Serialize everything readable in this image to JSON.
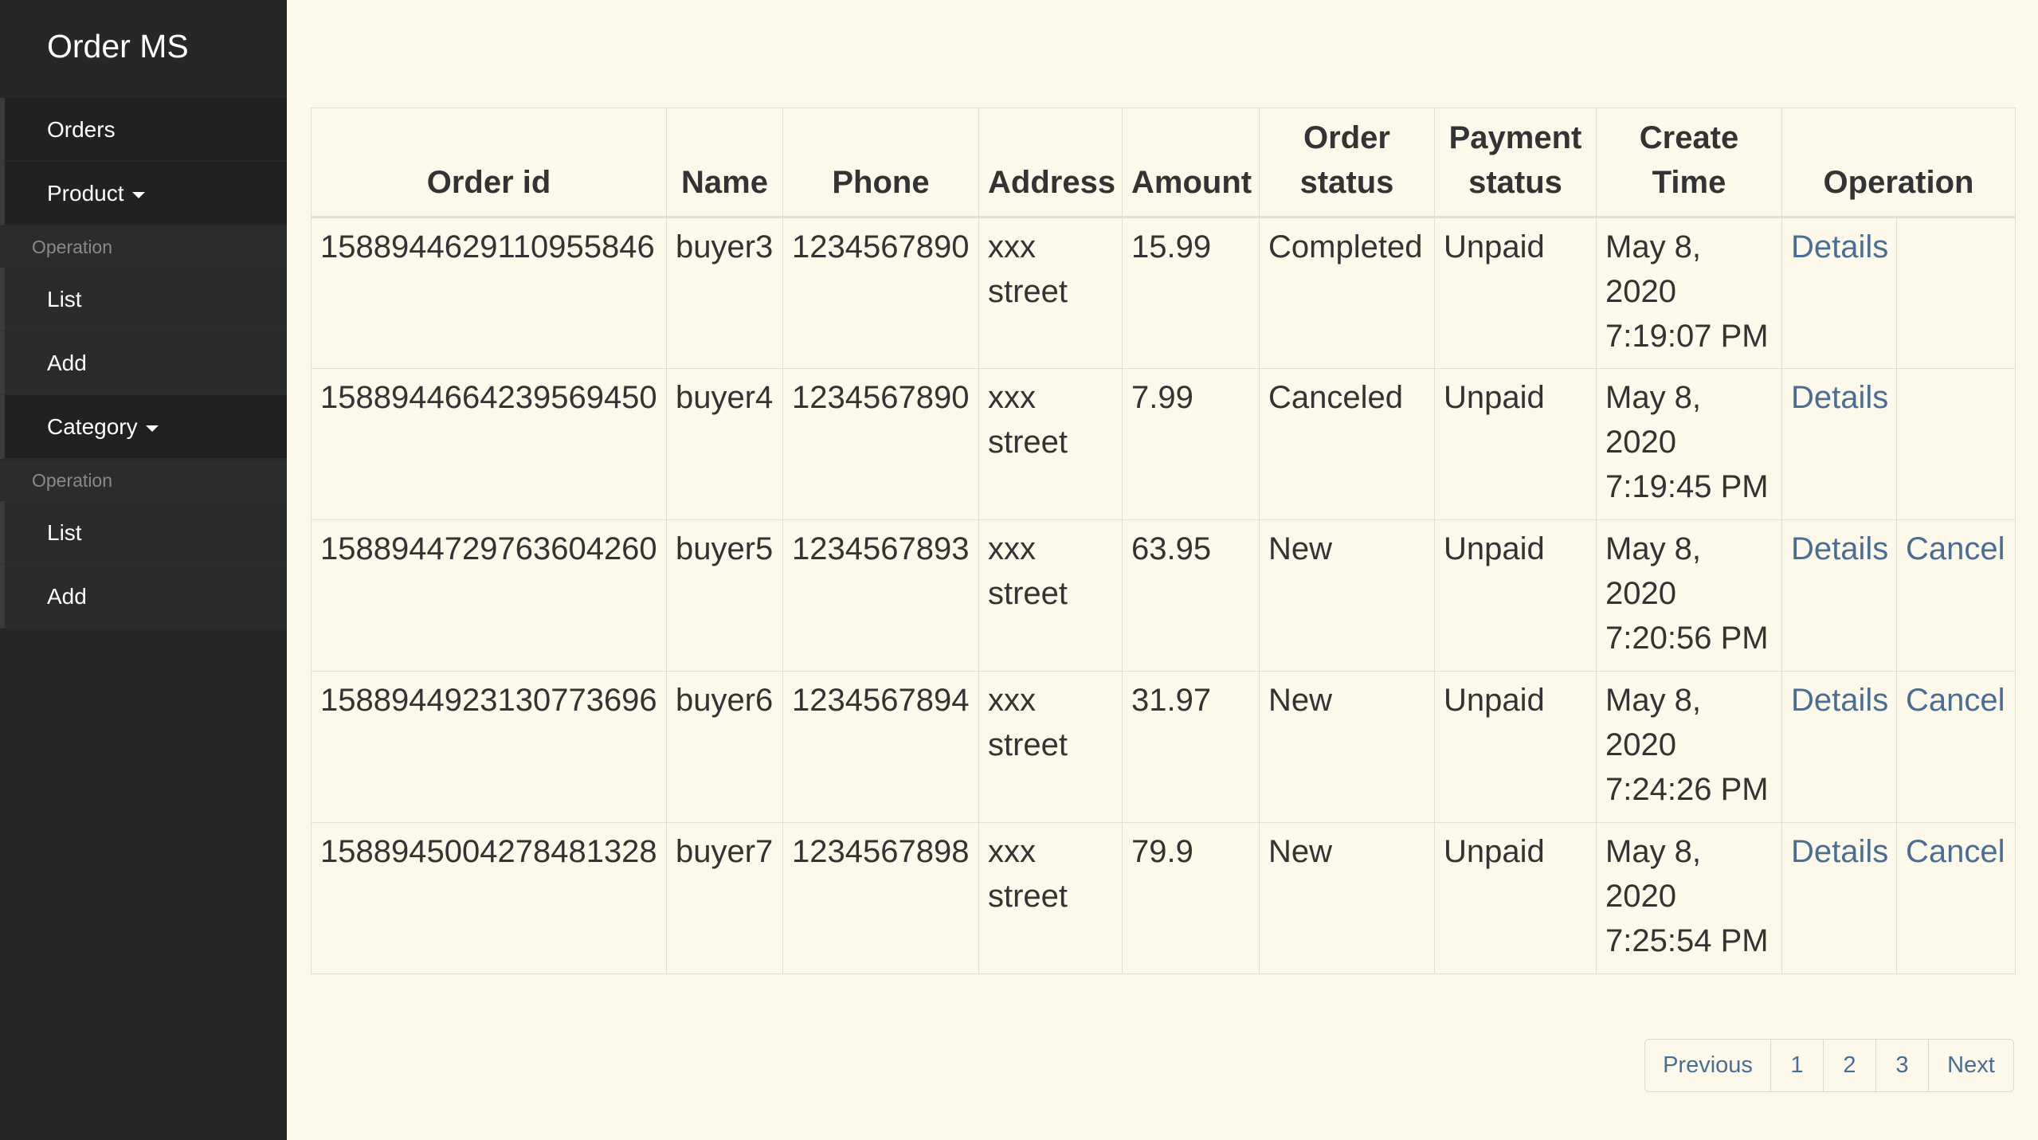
{
  "app": {
    "title": "Order MS"
  },
  "sidebar": {
    "orders_label": "Orders",
    "product_label": "Product",
    "product_header": "Operation",
    "product_list": "List",
    "product_add": "Add",
    "category_label": "Category",
    "category_header": "Operation",
    "category_list": "List",
    "category_add": "Add"
  },
  "table": {
    "headers": {
      "order_id": "Order id",
      "name": "Name",
      "phone": "Phone",
      "address": "Address",
      "amount": "Amount",
      "order_status": "Order status",
      "payment_status": "Payment status",
      "create_time": "Create Time",
      "operation": "Operation"
    },
    "rows": [
      {
        "order_id": "1588944629110955846",
        "name": "buyer3",
        "phone": "1234567890",
        "address": "xxx street",
        "amount": "15.99",
        "order_status": "Completed",
        "payment_status": "Unpaid",
        "create_time": "May 8, 2020 7:19:07 PM",
        "details": "Details",
        "cancel": ""
      },
      {
        "order_id": "1588944664239569450",
        "name": "buyer4",
        "phone": "1234567890",
        "address": "xxx street",
        "amount": "7.99",
        "order_status": "Canceled",
        "payment_status": "Unpaid",
        "create_time": "May 8, 2020 7:19:45 PM",
        "details": "Details",
        "cancel": ""
      },
      {
        "order_id": "1588944729763604260",
        "name": "buyer5",
        "phone": "1234567893",
        "address": "xxx street",
        "amount": "63.95",
        "order_status": "New",
        "payment_status": "Unpaid",
        "create_time": "May 8, 2020 7:20:56 PM",
        "details": "Details",
        "cancel": "Cancel"
      },
      {
        "order_id": "1588944923130773696",
        "name": "buyer6",
        "phone": "1234567894",
        "address": "xxx street",
        "amount": "31.97",
        "order_status": "New",
        "payment_status": "Unpaid",
        "create_time": "May 8, 2020 7:24:26 PM",
        "details": "Details",
        "cancel": "Cancel"
      },
      {
        "order_id": "1588945004278481328",
        "name": "buyer7",
        "phone": "1234567898",
        "address": "xxx street",
        "amount": "79.9",
        "order_status": "New",
        "payment_status": "Unpaid",
        "create_time": "May 8, 2020 7:25:54 PM",
        "details": "Details",
        "cancel": "Cancel"
      }
    ]
  },
  "pagination": {
    "previous": "Previous",
    "pages": [
      "1",
      "2",
      "3"
    ],
    "next": "Next"
  },
  "colors": {
    "sidebar_bg": "#262727",
    "page_bg": "#fdf9ea",
    "link": "#4a6d95"
  }
}
